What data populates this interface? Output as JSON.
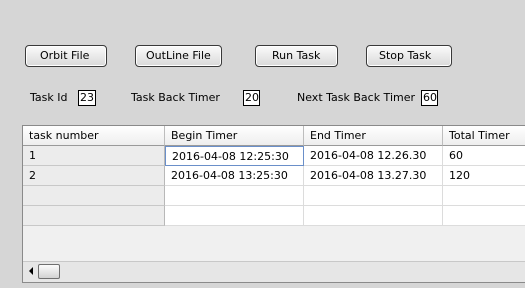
{
  "toolbar": {
    "orbit_file": "Orbit File",
    "outline_file": "OutLine File",
    "run_task": "Run Task",
    "stop_task": "Stop Task"
  },
  "params": {
    "task_id_label": "Task Id",
    "task_id_value": "23",
    "back_timer_label": "Task Back Timer",
    "back_timer_value": "20",
    "next_back_timer_label": "Next Task Back Timer",
    "next_back_timer_value": "60"
  },
  "grid": {
    "columns": [
      "task number",
      "Begin Timer",
      "End Timer",
      "Total Timer"
    ],
    "rows": [
      [
        "1",
        "2016-04-08 12:25:30",
        "2016-04-08 12.26.30",
        "60"
      ],
      [
        "2",
        "2016-04-08 13:25:30",
        "2016-04-08 13.27.30",
        "120"
      ]
    ]
  }
}
